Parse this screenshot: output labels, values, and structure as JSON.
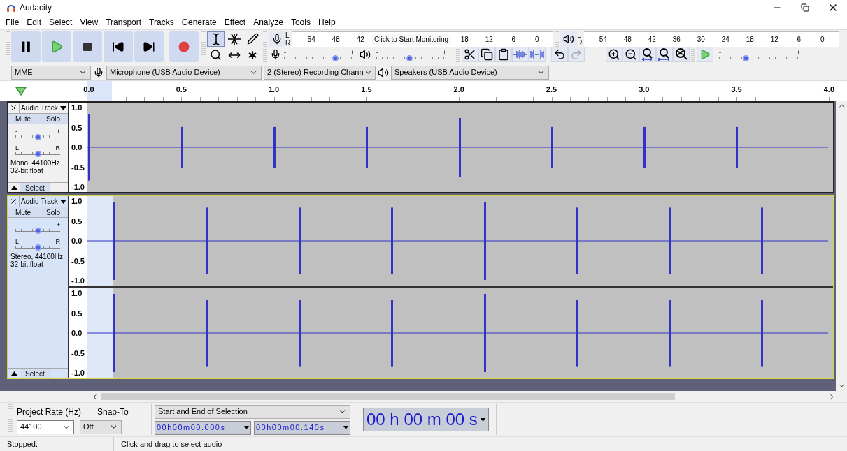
{
  "window": {
    "title": "Audacity",
    "controls": [
      {
        "kind": "minimize"
      },
      {
        "kind": "restore"
      },
      {
        "kind": "close"
      }
    ]
  },
  "menu": [
    "File",
    "Edit",
    "Select",
    "View",
    "Transport",
    "Tracks",
    "Generate",
    "Effect",
    "Analyze",
    "Tools",
    "Help"
  ],
  "transport": [
    {
      "kind": "pause"
    },
    {
      "kind": "play"
    },
    {
      "kind": "stop"
    },
    {
      "kind": "skip-start"
    },
    {
      "kind": "skip-end"
    },
    {
      "kind": "record"
    }
  ],
  "tools": [
    {
      "kind": "select",
      "selected": true
    },
    {
      "kind": "envelope",
      "selected": false
    },
    {
      "kind": "draw",
      "selected": false
    },
    {
      "kind": "zoom",
      "selected": false
    },
    {
      "kind": "time-shift",
      "selected": false
    },
    {
      "kind": "multi",
      "selected": false
    }
  ],
  "recording_meter": {
    "channels": [
      "L",
      "R"
    ],
    "ticks": [
      "-54",
      "-48",
      "-42"
    ],
    "prompt": "Click to Start Monitoring",
    "ticks_after": [
      "-18",
      "-12",
      "-6",
      "0"
    ]
  },
  "playback_meter": {
    "channels": [
      "L",
      "R"
    ],
    "ticks": [
      "-54",
      "-48",
      "-42",
      "-36",
      "-30",
      "-24",
      "-18",
      "-12",
      "-6",
      "0"
    ]
  },
  "mixer": {
    "recording_volume": {
      "minus": "-",
      "plus": "+",
      "level": 0.72
    },
    "playback_volume": {
      "minus": "-",
      "plus": "+",
      "level": 0.47
    }
  },
  "edit_tools": [
    {
      "kind": "cut",
      "disabled": false
    },
    {
      "kind": "copy",
      "disabled": false
    },
    {
      "kind": "paste",
      "disabled": false
    },
    {
      "kind": "trim",
      "disabled": false
    },
    {
      "kind": "silence",
      "disabled": false
    },
    {
      "kind": "undo",
      "disabled": false
    },
    {
      "kind": "redo",
      "disabled": true
    }
  ],
  "zoom_tools": [
    {
      "kind": "zoom-in"
    },
    {
      "kind": "zoom-out"
    },
    {
      "kind": "fit-selection"
    },
    {
      "kind": "fit-project"
    },
    {
      "kind": "zoom-toggle"
    }
  ],
  "play_at_speed": {
    "minus": "-",
    "plus": "+",
    "level": 0.33
  },
  "devices": {
    "host": "MME",
    "recording_device": "Microphone (USB Audio Device)",
    "recording_channels": "2 (Stereo) Recording Chann",
    "playback_device": "Speakers (USB Audio Device)"
  },
  "ruler": {
    "ticks": [
      "0.0",
      "0.5",
      "1.0",
      "1.5",
      "2.0",
      "2.5",
      "3.0",
      "3.5",
      "4.0"
    ]
  },
  "tracks": [
    {
      "name": "Audio Track",
      "selected": false,
      "mute": "Mute",
      "solo": "Solo",
      "gain": {
        "minus": "-",
        "plus": "+",
        "level": 0.5
      },
      "pan": {
        "left": "L",
        "right": "R",
        "level": 0.5
      },
      "info": [
        "Mono, 44100Hz",
        "32-bit float"
      ],
      "select": "Select",
      "channels": [
        {
          "scale": [
            "1.0",
            "0.5",
            "0.0",
            "-0.5",
            "-1.0"
          ]
        }
      ]
    },
    {
      "name": "Audio Track",
      "selected": true,
      "mute": "Mute",
      "solo": "Solo",
      "gain": {
        "minus": "-",
        "plus": "+",
        "level": 0.5
      },
      "pan": {
        "left": "L",
        "right": "R",
        "level": 0.5
      },
      "info": [
        "Stereo, 44100Hz",
        "32-bit float"
      ],
      "select": "Select",
      "channels": [
        {
          "scale": [
            "1.0",
            "0.5",
            "0.0",
            "-0.5",
            "-1.0"
          ]
        },
        {
          "scale": [
            "1.0",
            "0.5",
            "0.0",
            "-0.5",
            "-1.0"
          ]
        }
      ]
    }
  ],
  "selection_toolbar": {
    "project_rate_label": "Project Rate (Hz)",
    "project_rate": "44100",
    "snap_to_label": "Snap-To",
    "snap_to": "Off",
    "selection_mode": "Start and End of Selection",
    "start": "00h00m00.000s",
    "end": "00h00m00.140s"
  },
  "time_display": "00 h 00 m 00 s",
  "status_bar": [
    "Stopped.",
    "Click and drag to select audio"
  ]
}
